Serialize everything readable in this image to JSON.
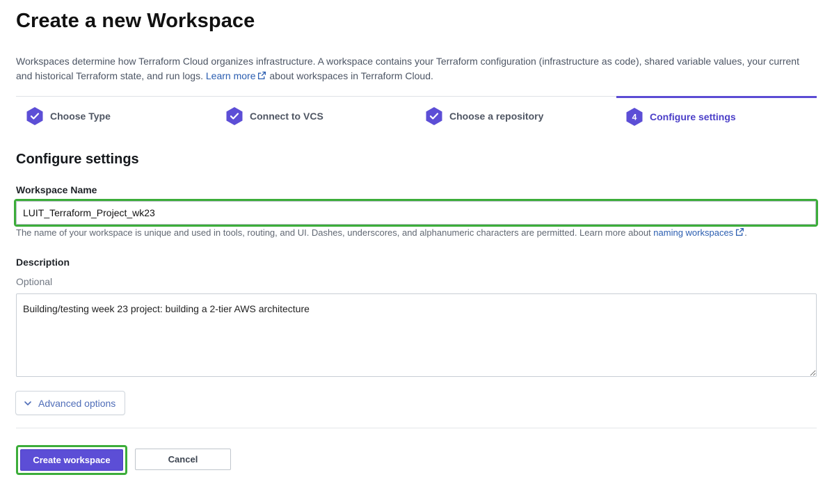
{
  "page": {
    "title": "Create a new Workspace",
    "intro_before_link": "Workspaces determine how Terraform Cloud organizes infrastructure. A workspace contains your Terraform configuration (infrastructure as code), shared variable values, your current and historical Terraform state, and run logs. ",
    "intro_link": "Learn more",
    "intro_after_link": " about workspaces in Terraform Cloud."
  },
  "steps": [
    {
      "label": "Choose Type",
      "status": "complete",
      "icon": "check-hex-icon"
    },
    {
      "label": "Connect to VCS",
      "status": "complete",
      "icon": "check-hex-icon"
    },
    {
      "label": "Choose a repository",
      "status": "complete",
      "icon": "check-hex-icon"
    },
    {
      "label": "Configure settings",
      "status": "active",
      "number": "4",
      "icon": "number-hex-icon"
    }
  ],
  "form": {
    "section_title": "Configure settings",
    "workspace_name_label": "Workspace Name",
    "workspace_name_value": "LUIT_Terraform_Project_wk23",
    "workspace_name_helper": "The name of your workspace is unique and used in tools, routing, and UI. Dashes, underscores, and alphanumeric characters are permitted. Learn more about ",
    "workspace_name_helper_link": "naming workspaces",
    "workspace_name_helper_end": ".",
    "description_label": "Description",
    "description_optional": "Optional",
    "description_value": "Building/testing week 23 project: building a 2-tier AWS architecture",
    "advanced_options_label": "Advanced options"
  },
  "actions": {
    "create_label": "Create workspace",
    "cancel_label": "Cancel"
  },
  "colors": {
    "accent": "#5c4ed6",
    "link": "#2a5db0",
    "highlight": "#3cad3a"
  }
}
